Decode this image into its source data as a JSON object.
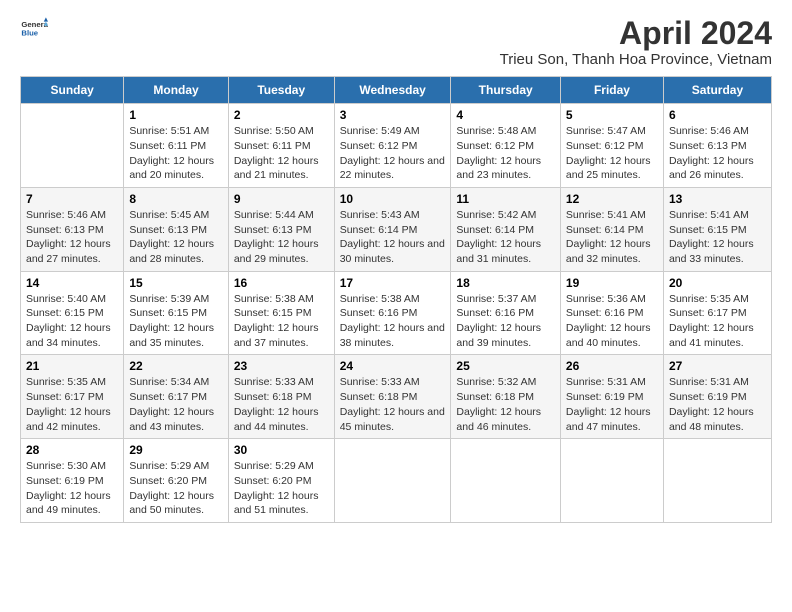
{
  "logo": {
    "text_general": "General",
    "text_blue": "Blue"
  },
  "title": "April 2024",
  "subtitle": "Trieu Son, Thanh Hoa Province, Vietnam",
  "weekdays": [
    "Sunday",
    "Monday",
    "Tuesday",
    "Wednesday",
    "Thursday",
    "Friday",
    "Saturday"
  ],
  "weeks": [
    [
      {
        "day": "",
        "sunrise": "",
        "sunset": "",
        "daylight": ""
      },
      {
        "day": "1",
        "sunrise": "Sunrise: 5:51 AM",
        "sunset": "Sunset: 6:11 PM",
        "daylight": "Daylight: 12 hours and 20 minutes."
      },
      {
        "day": "2",
        "sunrise": "Sunrise: 5:50 AM",
        "sunset": "Sunset: 6:11 PM",
        "daylight": "Daylight: 12 hours and 21 minutes."
      },
      {
        "day": "3",
        "sunrise": "Sunrise: 5:49 AM",
        "sunset": "Sunset: 6:12 PM",
        "daylight": "Daylight: 12 hours and 22 minutes."
      },
      {
        "day": "4",
        "sunrise": "Sunrise: 5:48 AM",
        "sunset": "Sunset: 6:12 PM",
        "daylight": "Daylight: 12 hours and 23 minutes."
      },
      {
        "day": "5",
        "sunrise": "Sunrise: 5:47 AM",
        "sunset": "Sunset: 6:12 PM",
        "daylight": "Daylight: 12 hours and 25 minutes."
      },
      {
        "day": "6",
        "sunrise": "Sunrise: 5:46 AM",
        "sunset": "Sunset: 6:13 PM",
        "daylight": "Daylight: 12 hours and 26 minutes."
      }
    ],
    [
      {
        "day": "7",
        "sunrise": "Sunrise: 5:46 AM",
        "sunset": "Sunset: 6:13 PM",
        "daylight": "Daylight: 12 hours and 27 minutes."
      },
      {
        "day": "8",
        "sunrise": "Sunrise: 5:45 AM",
        "sunset": "Sunset: 6:13 PM",
        "daylight": "Daylight: 12 hours and 28 minutes."
      },
      {
        "day": "9",
        "sunrise": "Sunrise: 5:44 AM",
        "sunset": "Sunset: 6:13 PM",
        "daylight": "Daylight: 12 hours and 29 minutes."
      },
      {
        "day": "10",
        "sunrise": "Sunrise: 5:43 AM",
        "sunset": "Sunset: 6:14 PM",
        "daylight": "Daylight: 12 hours and 30 minutes."
      },
      {
        "day": "11",
        "sunrise": "Sunrise: 5:42 AM",
        "sunset": "Sunset: 6:14 PM",
        "daylight": "Daylight: 12 hours and 31 minutes."
      },
      {
        "day": "12",
        "sunrise": "Sunrise: 5:41 AM",
        "sunset": "Sunset: 6:14 PM",
        "daylight": "Daylight: 12 hours and 32 minutes."
      },
      {
        "day": "13",
        "sunrise": "Sunrise: 5:41 AM",
        "sunset": "Sunset: 6:15 PM",
        "daylight": "Daylight: 12 hours and 33 minutes."
      }
    ],
    [
      {
        "day": "14",
        "sunrise": "Sunrise: 5:40 AM",
        "sunset": "Sunset: 6:15 PM",
        "daylight": "Daylight: 12 hours and 34 minutes."
      },
      {
        "day": "15",
        "sunrise": "Sunrise: 5:39 AM",
        "sunset": "Sunset: 6:15 PM",
        "daylight": "Daylight: 12 hours and 35 minutes."
      },
      {
        "day": "16",
        "sunrise": "Sunrise: 5:38 AM",
        "sunset": "Sunset: 6:15 PM",
        "daylight": "Daylight: 12 hours and 37 minutes."
      },
      {
        "day": "17",
        "sunrise": "Sunrise: 5:38 AM",
        "sunset": "Sunset: 6:16 PM",
        "daylight": "Daylight: 12 hours and 38 minutes."
      },
      {
        "day": "18",
        "sunrise": "Sunrise: 5:37 AM",
        "sunset": "Sunset: 6:16 PM",
        "daylight": "Daylight: 12 hours and 39 minutes."
      },
      {
        "day": "19",
        "sunrise": "Sunrise: 5:36 AM",
        "sunset": "Sunset: 6:16 PM",
        "daylight": "Daylight: 12 hours and 40 minutes."
      },
      {
        "day": "20",
        "sunrise": "Sunrise: 5:35 AM",
        "sunset": "Sunset: 6:17 PM",
        "daylight": "Daylight: 12 hours and 41 minutes."
      }
    ],
    [
      {
        "day": "21",
        "sunrise": "Sunrise: 5:35 AM",
        "sunset": "Sunset: 6:17 PM",
        "daylight": "Daylight: 12 hours and 42 minutes."
      },
      {
        "day": "22",
        "sunrise": "Sunrise: 5:34 AM",
        "sunset": "Sunset: 6:17 PM",
        "daylight": "Daylight: 12 hours and 43 minutes."
      },
      {
        "day": "23",
        "sunrise": "Sunrise: 5:33 AM",
        "sunset": "Sunset: 6:18 PM",
        "daylight": "Daylight: 12 hours and 44 minutes."
      },
      {
        "day": "24",
        "sunrise": "Sunrise: 5:33 AM",
        "sunset": "Sunset: 6:18 PM",
        "daylight": "Daylight: 12 hours and 45 minutes."
      },
      {
        "day": "25",
        "sunrise": "Sunrise: 5:32 AM",
        "sunset": "Sunset: 6:18 PM",
        "daylight": "Daylight: 12 hours and 46 minutes."
      },
      {
        "day": "26",
        "sunrise": "Sunrise: 5:31 AM",
        "sunset": "Sunset: 6:19 PM",
        "daylight": "Daylight: 12 hours and 47 minutes."
      },
      {
        "day": "27",
        "sunrise": "Sunrise: 5:31 AM",
        "sunset": "Sunset: 6:19 PM",
        "daylight": "Daylight: 12 hours and 48 minutes."
      }
    ],
    [
      {
        "day": "28",
        "sunrise": "Sunrise: 5:30 AM",
        "sunset": "Sunset: 6:19 PM",
        "daylight": "Daylight: 12 hours and 49 minutes."
      },
      {
        "day": "29",
        "sunrise": "Sunrise: 5:29 AM",
        "sunset": "Sunset: 6:20 PM",
        "daylight": "Daylight: 12 hours and 50 minutes."
      },
      {
        "day": "30",
        "sunrise": "Sunrise: 5:29 AM",
        "sunset": "Sunset: 6:20 PM",
        "daylight": "Daylight: 12 hours and 51 minutes."
      },
      {
        "day": "",
        "sunrise": "",
        "sunset": "",
        "daylight": ""
      },
      {
        "day": "",
        "sunrise": "",
        "sunset": "",
        "daylight": ""
      },
      {
        "day": "",
        "sunrise": "",
        "sunset": "",
        "daylight": ""
      },
      {
        "day": "",
        "sunrise": "",
        "sunset": "",
        "daylight": ""
      }
    ]
  ]
}
